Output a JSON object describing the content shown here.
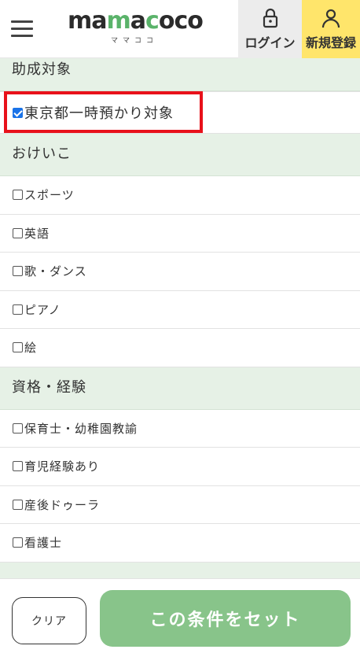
{
  "header": {
    "logo_text": "mamacoco",
    "logo_sub": "ママココ",
    "login_label": "ログイン",
    "signup_label": "新規登録"
  },
  "sections": [
    {
      "title": "助成対象",
      "items": [
        {
          "label": "東京都一時預かり対象",
          "checked": true
        }
      ]
    },
    {
      "title": "おけいこ",
      "items": [
        {
          "label": "スポーツ",
          "checked": false
        },
        {
          "label": "英語",
          "checked": false
        },
        {
          "label": "歌・ダンス",
          "checked": false
        },
        {
          "label": "ピアノ",
          "checked": false
        },
        {
          "label": "絵",
          "checked": false
        }
      ]
    },
    {
      "title": "資格・経験",
      "items": [
        {
          "label": "保育士・幼稚園教諭",
          "checked": false
        },
        {
          "label": "育児経験あり",
          "checked": false
        },
        {
          "label": "産後ドゥーラ",
          "checked": false
        },
        {
          "label": "看護士",
          "checked": false
        }
      ]
    }
  ],
  "footer": {
    "clear_label": "クリア",
    "set_label": "この条件をセット"
  },
  "colors": {
    "section_bg": "#e6f1e6",
    "signup_bg": "#ffe56b",
    "login_bg": "#ececec",
    "set_button_bg": "#88c48a",
    "highlight": "#e8111a",
    "checkbox_checked": "#1a73e8"
  },
  "icons": {
    "menu": "hamburger-menu-icon",
    "login": "lock-icon",
    "signup": "person-icon"
  }
}
